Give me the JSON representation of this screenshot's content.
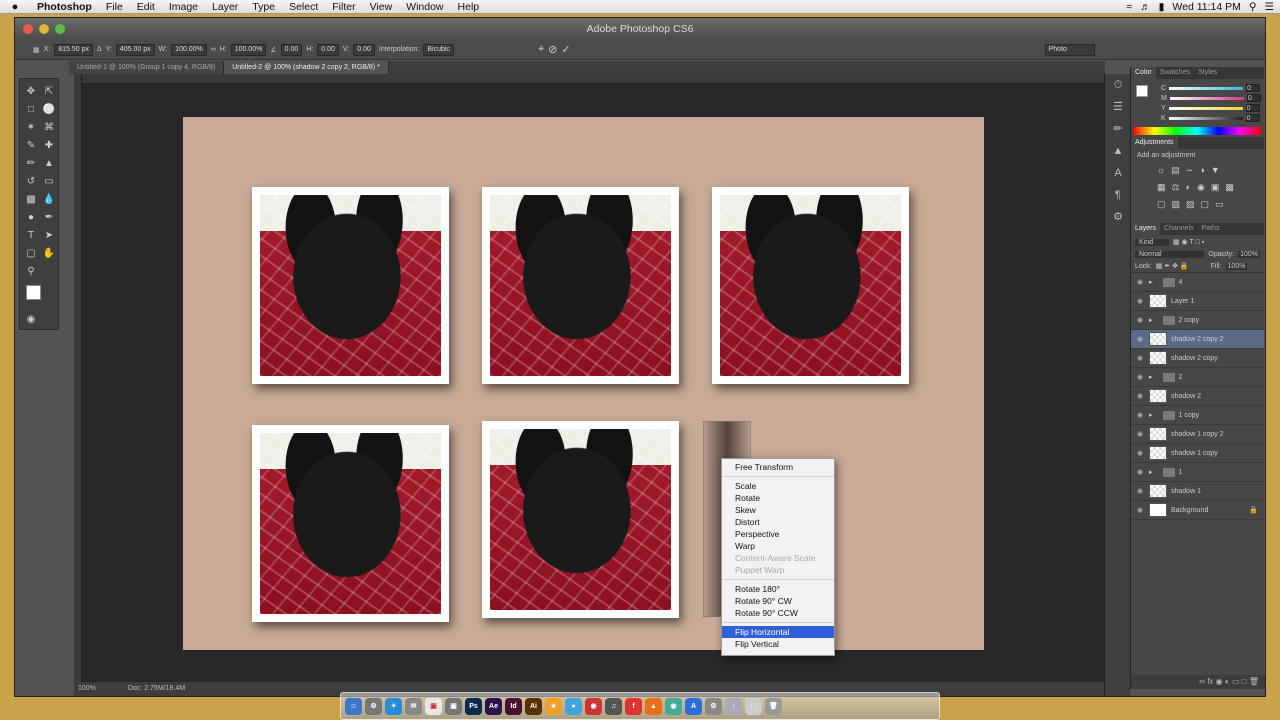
{
  "menubar": {
    "apple": "",
    "items": [
      "Photoshop",
      "File",
      "Edit",
      "Image",
      "Layer",
      "Type",
      "Select",
      "Filter",
      "View",
      "Window",
      "Help"
    ],
    "clock": "Wed 11:14 PM"
  },
  "window": {
    "title": "Adobe Photoshop CS6"
  },
  "options_bar": {
    "x": "815.50 px",
    "y": "405.00 px",
    "w": "100.00%",
    "h": "100.00%",
    "angle": "0.00",
    "h_skew": "0.00",
    "v_skew": "0.00",
    "interpolation_label": "Interpolation:",
    "interpolation_value": "Bicubic",
    "workspace": "Photo"
  },
  "doc_tabs": [
    {
      "label": "Untitled-1 @ 100% (Group 1 copy 4, RGB/8)"
    },
    {
      "label": "Untitled-2 @ 100% (shadow 2 copy 2, RGB/8) *"
    }
  ],
  "context_menu": {
    "items": [
      {
        "label": "Free Transform",
        "state": "normal"
      },
      {
        "sep": true
      },
      {
        "label": "Scale",
        "state": "normal"
      },
      {
        "label": "Rotate",
        "state": "normal"
      },
      {
        "label": "Skew",
        "state": "normal"
      },
      {
        "label": "Distort",
        "state": "normal"
      },
      {
        "label": "Perspective",
        "state": "normal"
      },
      {
        "label": "Warp",
        "state": "normal"
      },
      {
        "label": "Content-Aware Scale",
        "state": "disabled"
      },
      {
        "label": "Puppet Warp",
        "state": "disabled"
      },
      {
        "sep": true
      },
      {
        "label": "Rotate 180°",
        "state": "normal"
      },
      {
        "label": "Rotate 90° CW",
        "state": "normal"
      },
      {
        "label": "Rotate 90° CCW",
        "state": "normal"
      },
      {
        "sep": true
      },
      {
        "label": "Flip Horizontal",
        "state": "selected"
      },
      {
        "label": "Flip Vertical",
        "state": "normal"
      }
    ]
  },
  "status_bar": {
    "zoom": "100%",
    "doc": "Doc: 2.75M/18.4M"
  },
  "panels": {
    "color_tabs": [
      "Color",
      "Swatches",
      "Styles"
    ],
    "sliders": [
      {
        "label": "C",
        "value": "0",
        "color": "#38b6d8"
      },
      {
        "label": "M",
        "value": "0",
        "color": "#d23a8a"
      },
      {
        "label": "Y",
        "value": "0",
        "color": "#e6d43a"
      },
      {
        "label": "K",
        "value": "0",
        "color": "#888888"
      }
    ],
    "adjustments_tab": "Adjustments",
    "adjustments_label": "Add an adjustment",
    "layers_tabs": [
      "Layers",
      "Channels",
      "Paths"
    ],
    "kind": "Kind",
    "blend": "Normal",
    "opacity_label": "Opacity:",
    "opacity": "100%",
    "lock_label": "Lock:",
    "fill_label": "Fill:",
    "fill": "100%",
    "layers": [
      {
        "name": "4",
        "type": "folder",
        "selected": false
      },
      {
        "name": "Layer 1",
        "type": "layer",
        "selected": false
      },
      {
        "name": "2 copy",
        "type": "folder",
        "selected": false
      },
      {
        "name": "shadow 2 copy 2",
        "type": "layer",
        "selected": true
      },
      {
        "name": "shadow 2 copy",
        "type": "layer",
        "selected": false
      },
      {
        "name": "2",
        "type": "folder",
        "selected": false
      },
      {
        "name": "shadow 2",
        "type": "layer",
        "selected": false
      },
      {
        "name": "1 copy",
        "type": "folder",
        "selected": false
      },
      {
        "name": "shadow 1 copy 2",
        "type": "layer",
        "selected": false
      },
      {
        "name": "shadow 1 copy",
        "type": "layer",
        "selected": false
      },
      {
        "name": "1",
        "type": "folder",
        "selected": false
      },
      {
        "name": "shadow 1",
        "type": "layer",
        "selected": false
      },
      {
        "name": "Background",
        "type": "background",
        "selected": false
      }
    ]
  },
  "dock": [
    {
      "label": "Ps",
      "color": "#0a2a52"
    },
    {
      "label": "Ae",
      "color": "#2a1150"
    },
    {
      "label": "Id",
      "color": "#4a1030"
    },
    {
      "label": "Ai",
      "color": "#5a3200"
    }
  ]
}
